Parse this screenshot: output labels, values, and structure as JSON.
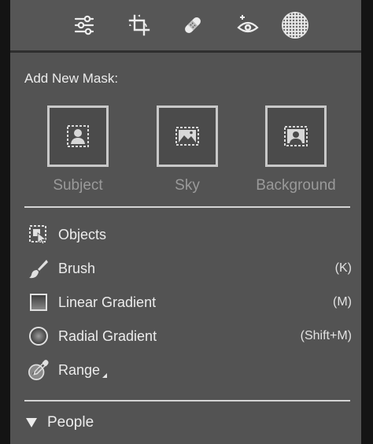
{
  "toolbar": {
    "tools": [
      {
        "icon": "sliders-icon",
        "name": "Edit"
      },
      {
        "icon": "crop-icon",
        "name": "Crop"
      },
      {
        "icon": "bandage-icon",
        "name": "Healing"
      },
      {
        "icon": "red-eye-icon",
        "name": "Red Eye"
      },
      {
        "icon": "masking-icon",
        "name": "Masking",
        "active": true
      }
    ]
  },
  "masking": {
    "title": "Add New Mask:",
    "quick_masks": [
      {
        "label": "Subject",
        "icon": "subject-person-icon"
      },
      {
        "label": "Sky",
        "icon": "sky-landscape-icon"
      },
      {
        "label": "Background",
        "icon": "background-icon"
      }
    ],
    "tools": [
      {
        "label": "Objects",
        "shortcut": "",
        "icon": "objects-icon"
      },
      {
        "label": "Brush",
        "shortcut": "(K)",
        "icon": "brush-icon"
      },
      {
        "label": "Linear Gradient",
        "shortcut": "(M)",
        "icon": "linear-gradient-icon"
      },
      {
        "label": "Radial Gradient",
        "shortcut": "(Shift+M)",
        "icon": "radial-gradient-icon"
      },
      {
        "label": "Range",
        "shortcut": "",
        "icon": "range-eyedropper-icon"
      }
    ],
    "people_section": {
      "label": "People",
      "expanded": true
    }
  },
  "colors": {
    "panel_bg": "#535353",
    "text": "#ececec",
    "muted_text": "#9a9a9a",
    "divider": "#d4d4d4"
  }
}
